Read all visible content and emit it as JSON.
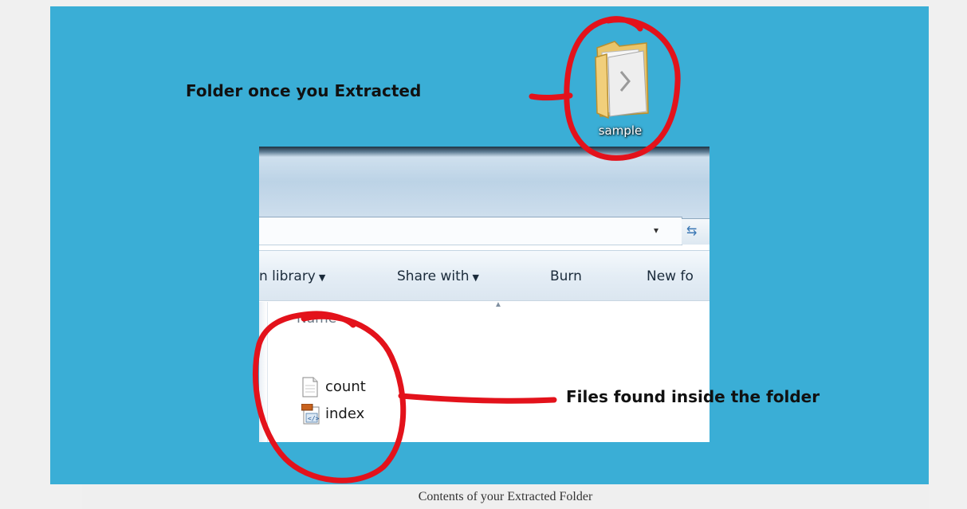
{
  "annotations": {
    "folder_note": "Folder once you Extracted",
    "files_note": "Files found inside the folder"
  },
  "desktop": {
    "folder_label": "sample",
    "folder_icon": "folder-icon"
  },
  "explorer": {
    "toolbar": {
      "library_label": "n library",
      "share_label": "Share with",
      "burn_label": "Burn",
      "new_folder_label": "New fo",
      "dropdown_glyph": "▼"
    },
    "address_dropdown_glyph": "▾",
    "refresh_icon": "refresh-icon",
    "column_header": "Name",
    "files": [
      {
        "name": "count",
        "icon": "text-file-icon"
      },
      {
        "name": "index",
        "icon": "html-file-icon"
      }
    ]
  },
  "caption": "Contents of your Extracted Folder",
  "colors": {
    "desktop_bg": "#3aaed6",
    "highlight_circle": "#e3121b",
    "caption_bg": "#efefef"
  }
}
